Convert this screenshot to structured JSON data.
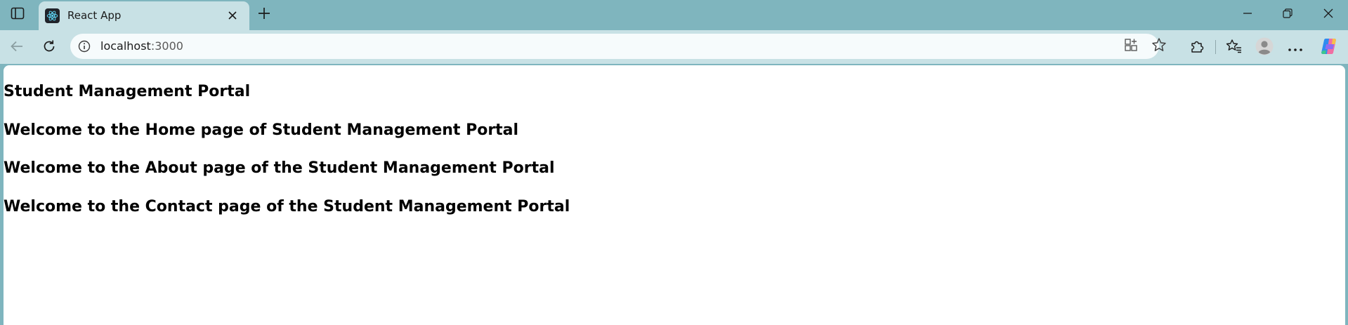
{
  "browser": {
    "tab": {
      "title": "React App",
      "favicon": "react-logo-icon"
    },
    "address_bar": {
      "host": "localhost",
      "port": ":3000"
    },
    "icons": {
      "tab_actions": "tab-actions-icon",
      "close_tab": "close-icon",
      "new_tab": "plus-icon",
      "minimize": "minimize-icon",
      "restore": "restore-icon",
      "close_window": "close-icon",
      "back": "back-arrow-icon",
      "refresh": "refresh-icon",
      "site_info": "info-icon",
      "app_available": "app-available-icon",
      "favorite": "star-icon",
      "extensions": "puzzle-icon",
      "favorites": "favorites-icon",
      "profile": "profile-icon",
      "more": "more-icon",
      "copilot": "copilot-icon"
    },
    "colors": {
      "frame": "#7fb5be",
      "toolbar": "#c8e1e5"
    }
  },
  "page": {
    "title": "Student Management Portal",
    "home_message": "Welcome to the Home page of Student Management Portal",
    "about_message": "Welcome to the About page of the Student Management Portal",
    "contact_message": "Welcome to the Contact page of the Student Management Portal"
  }
}
